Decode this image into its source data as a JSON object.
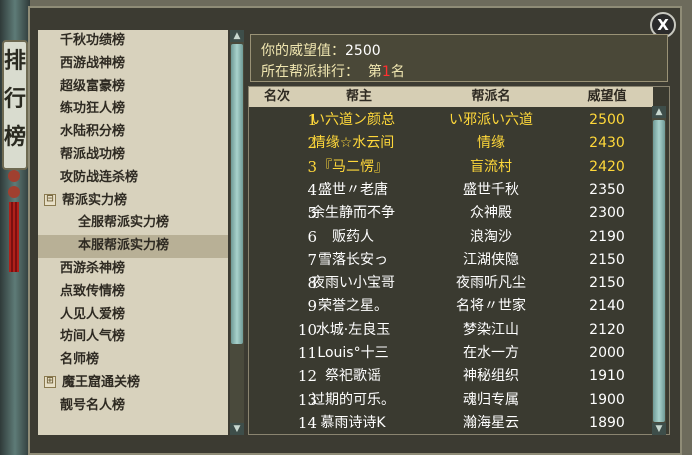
{
  "banner_text": "排行榜",
  "close_label": "X",
  "left_menu": [
    {
      "label": "千秋功绩榜",
      "type": "item",
      "selected": false
    },
    {
      "label": "西游战神榜",
      "type": "item",
      "selected": false
    },
    {
      "label": "超级富豪榜",
      "type": "item",
      "selected": false
    },
    {
      "label": "练功狂人榜",
      "type": "item",
      "selected": false
    },
    {
      "label": "水陆积分榜",
      "type": "item",
      "selected": false
    },
    {
      "label": "帮派战功榜",
      "type": "item",
      "selected": false
    },
    {
      "label": "攻防战连杀榜",
      "type": "item",
      "selected": false
    },
    {
      "label": "帮派实力榜",
      "type": "group",
      "expander": "⊟",
      "selected": false
    },
    {
      "label": "全服帮派实力榜",
      "type": "child",
      "selected": false
    },
    {
      "label": "本服帮派实力榜",
      "type": "child",
      "selected": true
    },
    {
      "label": "西游杀神榜",
      "type": "item",
      "selected": false
    },
    {
      "label": "点致传情榜",
      "type": "item",
      "selected": false
    },
    {
      "label": "人见人爱榜",
      "type": "item",
      "selected": false
    },
    {
      "label": "坊间人气榜",
      "type": "item",
      "selected": false
    },
    {
      "label": "名师榜",
      "type": "item",
      "selected": false
    },
    {
      "label": "魔王窟通关榜",
      "type": "group",
      "expander": "⊞",
      "selected": false
    },
    {
      "label": "靓号名人榜",
      "type": "item",
      "selected": false
    }
  ],
  "info": {
    "prestige_label": "你的威望值：",
    "prestige_value": "2500",
    "rank_label": "所在帮派排行：",
    "rank_prefix": "第",
    "rank_value": "1",
    "rank_suffix": "名"
  },
  "table": {
    "headers": [
      "名次",
      "帮主",
      "帮派名",
      "威望值"
    ],
    "rows": [
      {
        "rank": "1",
        "leader": "い六道ン颜总",
        "faction": "い邪派い六道",
        "prestige": "2500",
        "highlight": true
      },
      {
        "rank": "2",
        "leader": "情缘☆水云间",
        "faction": "情缘",
        "prestige": "2430",
        "highlight": true
      },
      {
        "rank": "3",
        "leader": "『马二愣』",
        "faction": "盲流村",
        "prestige": "2420",
        "highlight": true
      },
      {
        "rank": "4",
        "leader": "盛世〃老唐",
        "faction": "盛世千秋",
        "prestige": "2350",
        "highlight": false
      },
      {
        "rank": "5",
        "leader": "余生静而不争",
        "faction": "众神殿",
        "prestige": "2300",
        "highlight": false
      },
      {
        "rank": "6",
        "leader": "贩药人",
        "faction": "浪淘沙",
        "prestige": "2190",
        "highlight": false
      },
      {
        "rank": "7",
        "leader": "雪落长安っ",
        "faction": "江湖侠隐",
        "prestige": "2150",
        "highlight": false
      },
      {
        "rank": "8",
        "leader": "夜雨い小宝哥",
        "faction": "夜雨听凡尘",
        "prestige": "2150",
        "highlight": false
      },
      {
        "rank": "9",
        "leader": "荣誉之星。",
        "faction": "名将〃世家",
        "prestige": "2140",
        "highlight": false
      },
      {
        "rank": "10",
        "leader": "水城·左良玉",
        "faction": "梦染江山",
        "prestige": "2120",
        "highlight": false
      },
      {
        "rank": "11",
        "leader": "Louis°十三",
        "faction": "在水一方",
        "prestige": "2000",
        "highlight": false
      },
      {
        "rank": "12",
        "leader": "祭祀歌谣",
        "faction": "神秘组织",
        "prestige": "1910",
        "highlight": false
      },
      {
        "rank": "13",
        "leader": "过期的可乐。",
        "faction": "魂归专属",
        "prestige": "1900",
        "highlight": false
      },
      {
        "rank": "14",
        "leader": "慕雨诗诗K",
        "faction": "瀚海星云",
        "prestige": "1890",
        "highlight": false
      }
    ]
  },
  "colors": {
    "highlight": "#ffd83a",
    "normal": "#ffffff",
    "rank_red": "#ff3030"
  }
}
